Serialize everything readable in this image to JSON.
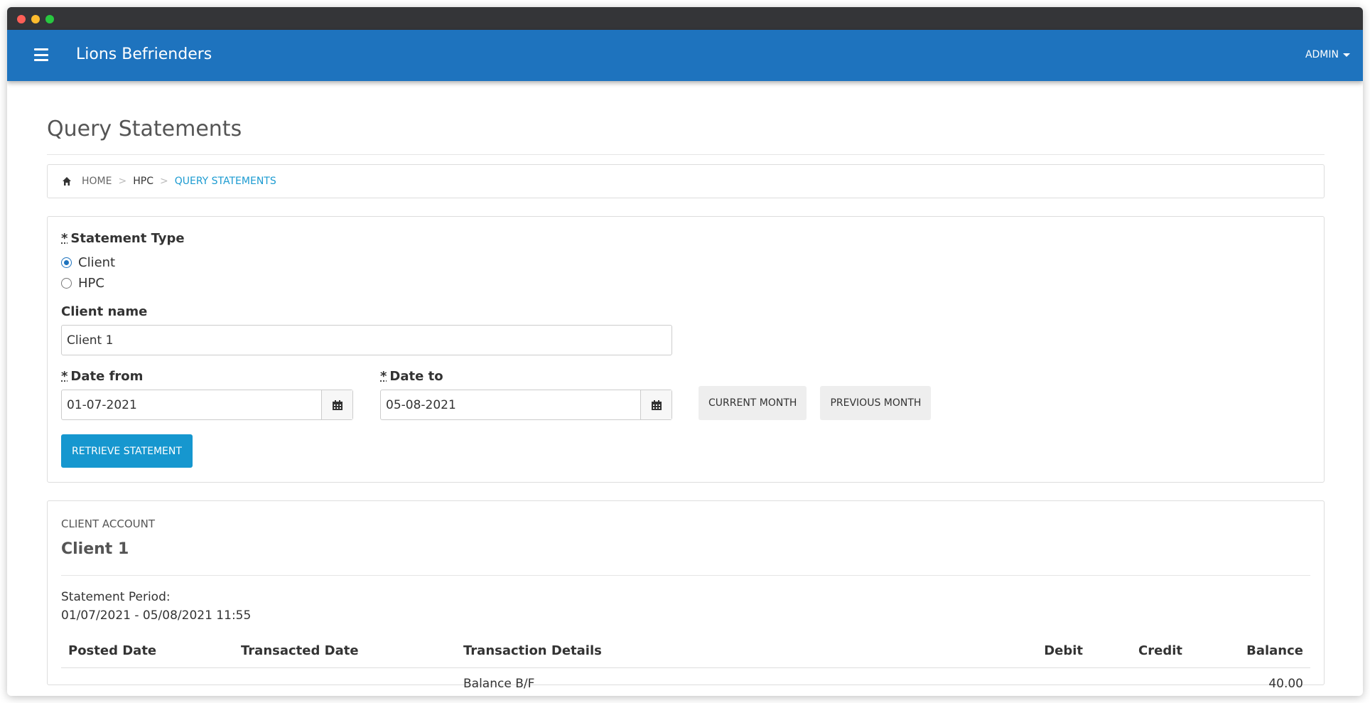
{
  "navbar": {
    "brand": "Lions Befrienders",
    "user_menu": "ADMIN"
  },
  "page": {
    "title": "Query Statements"
  },
  "breadcrumb": {
    "items": [
      "HOME",
      "HPC",
      "QUERY STATEMENTS"
    ]
  },
  "form": {
    "statement_type_label": "Statement Type",
    "required_marker": "*",
    "options": [
      {
        "label": "Client",
        "checked": true
      },
      {
        "label": "HPC",
        "checked": false
      }
    ],
    "client_name_label": "Client name",
    "client_name_value": "Client 1",
    "date_from_label": "Date from",
    "date_from_value": "01-07-2021",
    "date_to_label": "Date to",
    "date_to_value": "05-08-2021",
    "current_month_label": "CURRENT MONTH",
    "previous_month_label": "PREVIOUS MONTH",
    "retrieve_label": "RETRIEVE STATEMENT"
  },
  "statement": {
    "account_label": "CLIENT ACCOUNT",
    "account_name": "Client 1",
    "period_label": "Statement Period:",
    "period_value": "01/07/2021 - 05/08/2021 11:55",
    "columns": [
      "Posted Date",
      "Transacted Date",
      "Transaction Details",
      "Debit",
      "Credit",
      "Balance"
    ],
    "rows": [
      {
        "posted": "",
        "transacted": "",
        "details": "Balance B/F",
        "debit": "",
        "credit": "",
        "balance": "40.00"
      }
    ]
  },
  "colors": {
    "navbar": "#1e73be",
    "primary_button": "#1697cf",
    "breadcrumb_active": "#1c9bd1"
  }
}
